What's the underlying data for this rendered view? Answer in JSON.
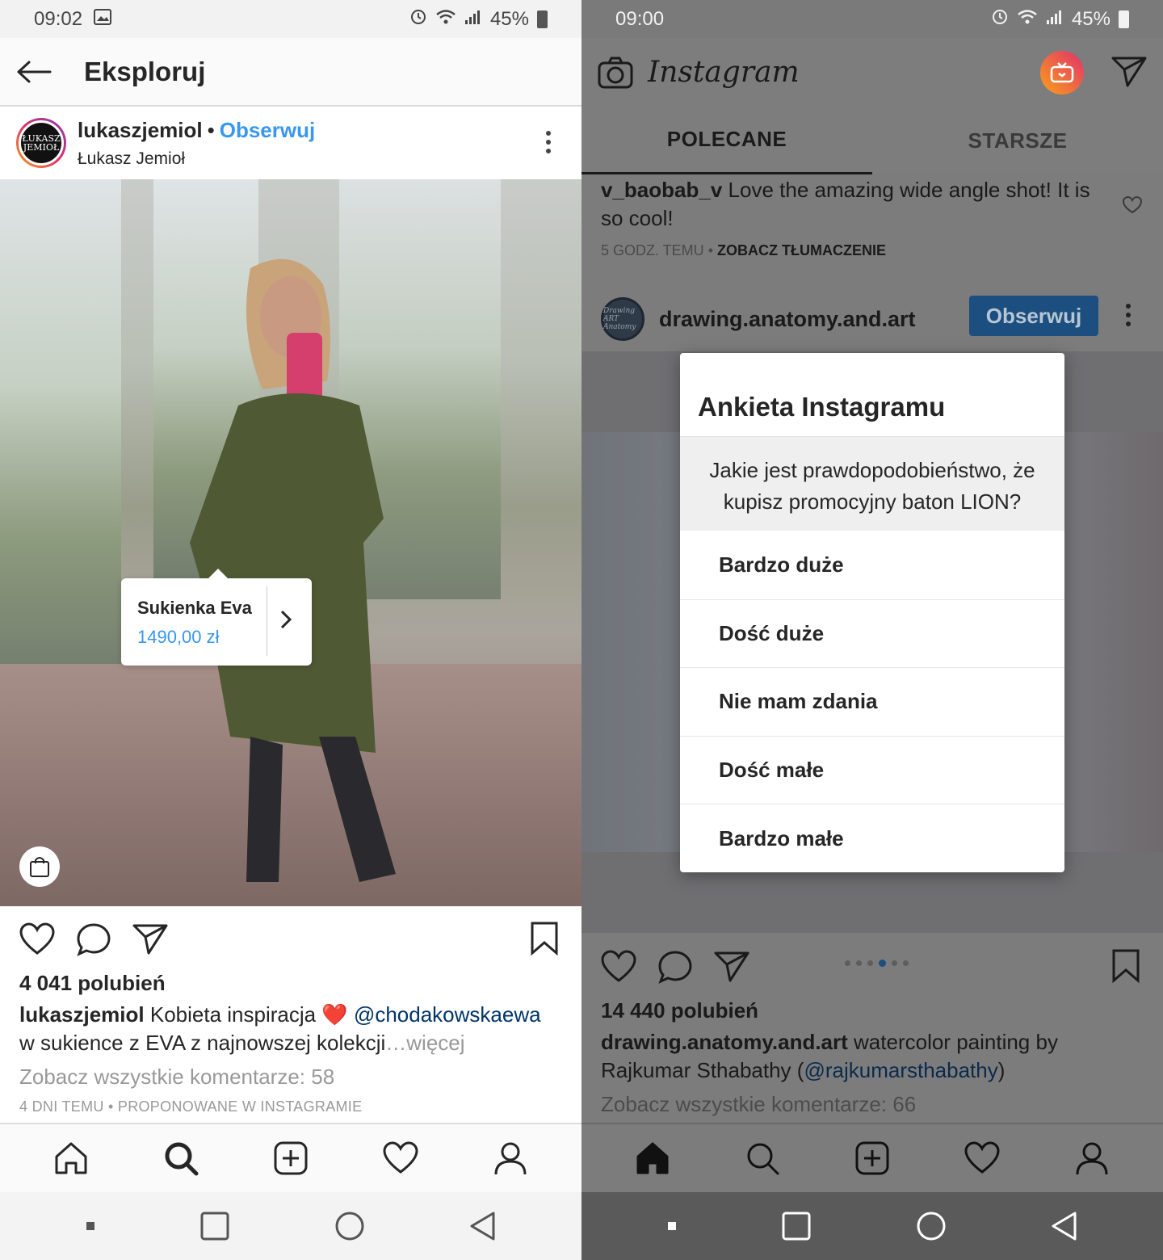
{
  "left": {
    "status": {
      "time": "09:02",
      "battery": "45%"
    },
    "header": {
      "title": "Eksploruj"
    },
    "post": {
      "username": "lukaszjemiol",
      "separator": "•",
      "follow_label": "Obserwuj",
      "display_name": "Łukasz Jemioł",
      "avatar_text": "ŁUKASZ JEMIOŁ",
      "product_tag": {
        "name": "Sukienka Eva",
        "price": "1490,00 zł"
      },
      "likes": "4 041 polubień",
      "caption_user": "lukaszjemiol",
      "caption_text_1": "Kobieta inspiracja",
      "caption_heart": "❤️",
      "caption_mention": "@chodakowskaewa",
      "caption_text_2": "w  sukience z EVA z najnowszej kolekcji",
      "caption_more": "…więcej",
      "view_all_comments": "Zobacz wszystkie komentarze: 58",
      "meta": "4 DNI TEMU • PROPONOWANE W INSTAGRAMIE"
    }
  },
  "right": {
    "status": {
      "time": "09:00",
      "battery": "45%"
    },
    "header": {
      "logo": "Instagram"
    },
    "tabs": [
      {
        "label": "POLECANE"
      },
      {
        "label": "STARSZE"
      }
    ],
    "comment": {
      "username": "v_baobab_v",
      "text": "Love the amazing wide angle shot! It is so cool!",
      "time": "5 GODZ. TEMU",
      "separator": "•",
      "translate": "ZOBACZ TŁUMACZENIE"
    },
    "post": {
      "username": "drawing.anatomy.and.art",
      "avatar_text": "Drawing ART Anatomy",
      "follow_label": "Obserwuj",
      "likes": "14 440 polubień",
      "caption_user": "drawing.anatomy.and.art",
      "caption_text": "watercolor painting by Rajkumar Sthabathy (",
      "caption_mention": "@rajkumarsthabathy",
      "caption_close": ")",
      "view_all_comments": "Zobacz wszystkie komentarze: 66",
      "carousel": {
        "count": 6,
        "active_index": 3
      }
    },
    "survey": {
      "title": "Ankieta Instagramu",
      "question": "Jakie jest prawdopodobieństwo, że kupisz promocyjny baton LION?",
      "options": [
        "Bardzo duże",
        "Dość duże",
        "Nie mam zdania",
        "Dość małe",
        "Bardzo małe"
      ]
    }
  },
  "icons": {
    "tabbar": [
      "home-icon",
      "search-icon",
      "add-post-icon",
      "activity-heart-icon",
      "profile-icon"
    ],
    "navbar": [
      "recent-apps-dot-icon",
      "overview-square-icon",
      "home-circle-icon",
      "back-triangle-icon"
    ]
  },
  "colors": {
    "link_blue": "#3897f0",
    "follow_dark": "#1c4f7f",
    "text": "#262626",
    "muted": "#999999"
  }
}
